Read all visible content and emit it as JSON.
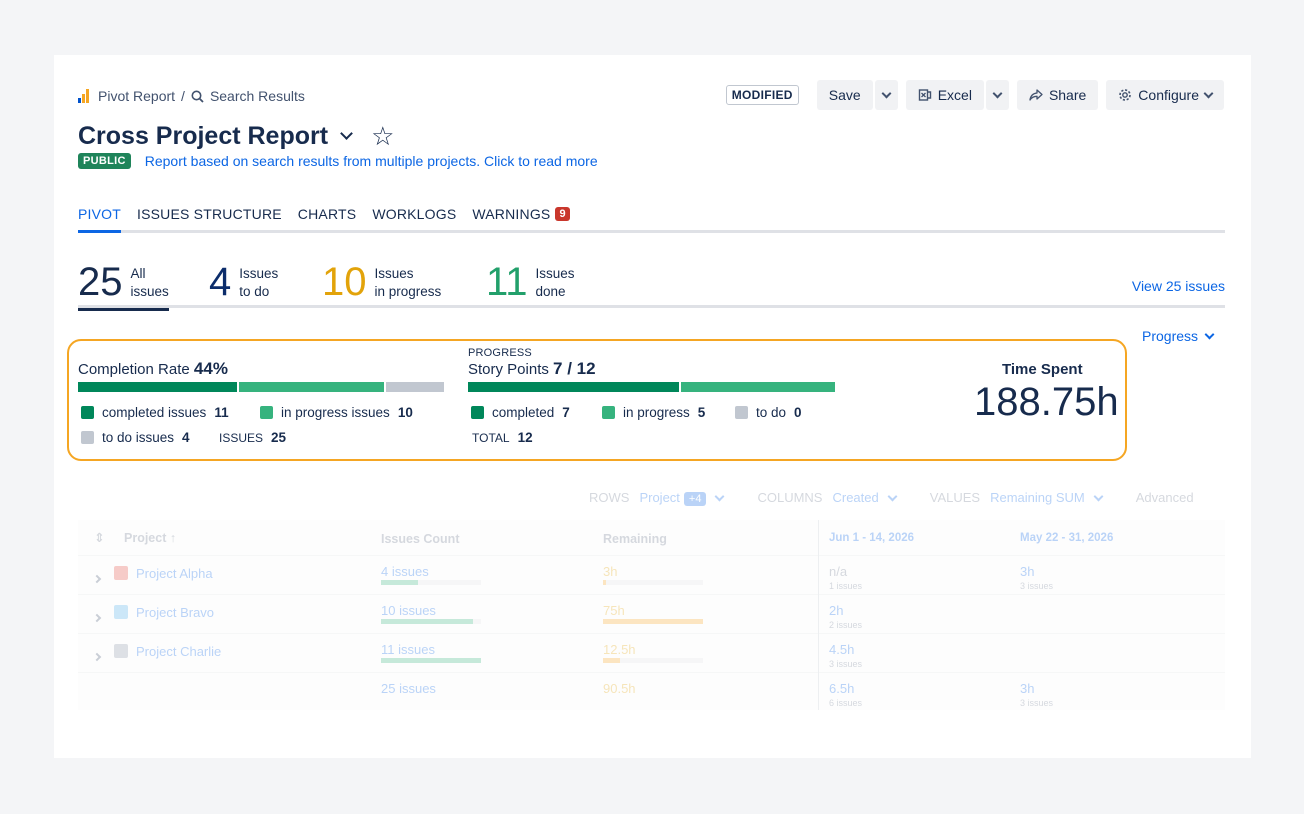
{
  "breadcrumb": {
    "root": "Pivot Report",
    "separator": "/",
    "current": "Search Results"
  },
  "header": {
    "modified": "MODIFIED",
    "save": "Save",
    "excel": "Excel",
    "share": "Share",
    "configure": "Configure"
  },
  "report": {
    "title": "Cross Project Report",
    "visibility": "PUBLIC",
    "description": "Report based on search results from multiple projects. Click to read more"
  },
  "tabs": [
    {
      "label": "PIVOT"
    },
    {
      "label": "ISSUES STRUCTURE"
    },
    {
      "label": "CHARTS"
    },
    {
      "label": "WORKLOGS"
    },
    {
      "label": "WARNINGS",
      "count": "9"
    }
  ],
  "stats": {
    "all": {
      "num": "25",
      "l1": "All",
      "l2": "issues",
      "color": "#172b4d"
    },
    "todo": {
      "num": "4",
      "l1": "Issues",
      "l2": "to do",
      "color": "#0c2d6b"
    },
    "inprogress": {
      "num": "10",
      "l1": "Issues",
      "l2": "in progress",
      "color": "#e2a30a"
    },
    "done": {
      "num": "11",
      "l1": "Issues",
      "l2": "done",
      "color": "#22a06b"
    },
    "view_link": "View 25 issues"
  },
  "progress_dropdown": "Progress",
  "completion": {
    "title": "Completion Rate",
    "rate": "44%",
    "completed_label": "completed issues",
    "completed": "11",
    "inprogress_label": "in progress issues",
    "inprogress": "10",
    "todo_label": "to do issues",
    "todo": "4",
    "issues_label": "ISSUES",
    "issues_total": "25",
    "fractions": [
      0.44,
      0.4,
      0.16
    ]
  },
  "story_points": {
    "caption": "PROGRESS",
    "title": "Story Points",
    "value": "7 / 12",
    "completed_label": "completed",
    "completed": "7",
    "inprogress_label": "in progress",
    "inprogress": "5",
    "todo_label": "to do",
    "todo": "0",
    "total_label": "TOTAL",
    "total": "12"
  },
  "time_spent": {
    "label": "Time Spent",
    "value": "188.75h"
  },
  "colors": {
    "done": "#00875a",
    "progress": "#36b37e",
    "todo": "#c1c7d0",
    "accent": "#0c66e4",
    "highlight": "#f5a623"
  },
  "pivot": {
    "toolbar": {
      "rows_label": "ROWS",
      "rows_value": "Project",
      "rows_extra": "+4",
      "columns_label": "COLUMNS",
      "columns_value": "Created",
      "values_label": "VALUES",
      "values_value": "Remaining SUM",
      "advanced": "Advanced"
    },
    "headers": {
      "project": "Project",
      "count": "Issues Count",
      "remaining": "Remaining",
      "col1": "Jun 1 - 14, 2026",
      "col2": "May 22 - 31, 2026"
    },
    "rows": [
      {
        "project": "Project Alpha",
        "count": "4 issues",
        "remaining": "3h",
        "c1": "n/a",
        "c1sub": "1 issues",
        "c2": "3h",
        "c2sub": "3 issues"
      },
      {
        "project": "Project Bravo",
        "count": "10 issues",
        "remaining": "75h",
        "c1": "2h",
        "c1sub": "2 issues",
        "c2": "",
        "c2sub": ""
      },
      {
        "project": "Project Charlie",
        "count": "11 issues",
        "remaining": "12.5h",
        "c1": "4.5h",
        "c1sub": "3 issues",
        "c2": "",
        "c2sub": ""
      }
    ],
    "totals": {
      "count": "25 issues",
      "remaining": "90.5h",
      "c1": "6.5h",
      "c1sub": "6 issues",
      "c2": "3h",
      "c2sub": "3 issues"
    }
  }
}
